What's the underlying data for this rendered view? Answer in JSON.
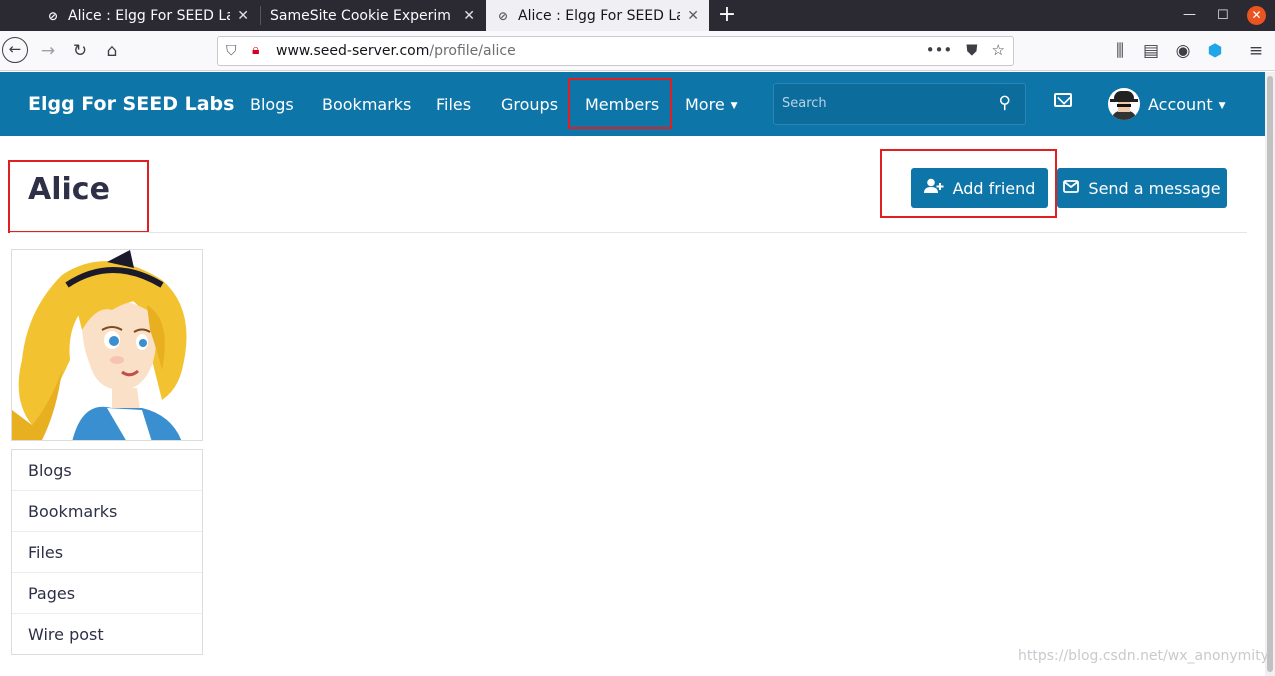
{
  "browser": {
    "tabs": [
      {
        "title": "Alice : Elgg For SEED Labs",
        "favicon": "elgg-icon",
        "active": false
      },
      {
        "title": "SameSite Cookie Experiment",
        "favicon": "",
        "active": false
      },
      {
        "title": "Alice : Elgg For SEED Labs",
        "favicon": "elgg-icon",
        "active": true
      }
    ],
    "url_host": "www.seed-server.com",
    "url_path": "/profile/alice"
  },
  "site": {
    "brand": "Elgg For SEED Labs",
    "nav": [
      "Blogs",
      "Bookmarks",
      "Files",
      "Groups",
      "Members",
      "More"
    ],
    "search_placeholder": "Search",
    "account_label": "Account"
  },
  "profile": {
    "name": "Alice",
    "add_friend_label": "Add friend",
    "send_message_label": "Send a message",
    "owner_menu": [
      "Blogs",
      "Bookmarks",
      "Files",
      "Pages",
      "Wire post"
    ]
  },
  "watermark": "https://blog.csdn.net/wx_anonymity",
  "colors": {
    "accent": "#0e75a8",
    "highlight": "#e02020"
  }
}
